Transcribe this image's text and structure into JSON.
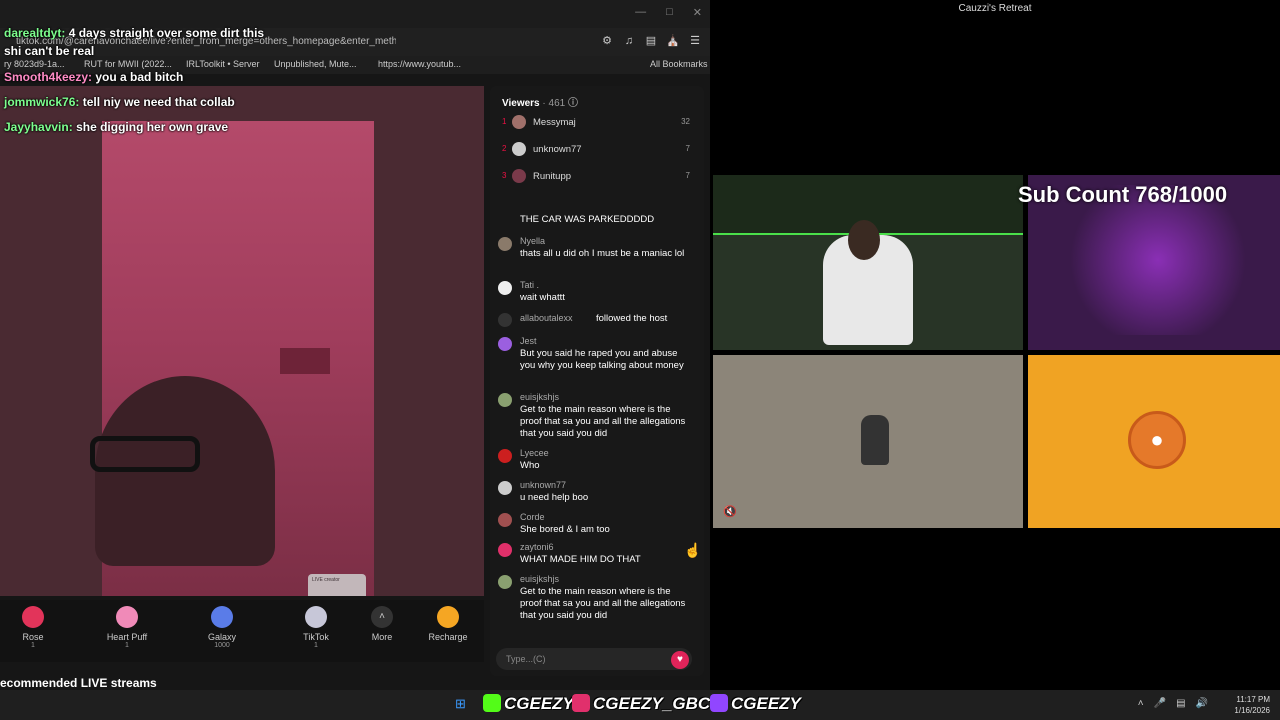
{
  "browser": {
    "url": "tiktok.com/@carenavonchaee/live?enter_from_merge=others_homepage&enter_metho...",
    "bookmarks": [
      "ry 8023d9-1a...",
      "RUT for MWII (2022...",
      "IRLToolkit • Server",
      "Unpublished, Mute...",
      "https://www.youtub...",
      "All Bookmarks"
    ]
  },
  "overlay_chat": [
    {
      "name": "darealtdyt:",
      "msg": "4 days straight over some dirt this"
    },
    {
      "name": "",
      "msg": "shi can't be real"
    },
    {
      "name": "Smooth4keezy:",
      "msg": "you a bad bitch"
    },
    {
      "name": "jommwick76:",
      "msg": "tell niy we need that collab"
    },
    {
      "name": "Jayyhavvin:",
      "msg": "she digging her own grave"
    }
  ],
  "gifts": [
    {
      "label": "Rose",
      "cost": "1",
      "color": "#e2345a"
    },
    {
      "label": "Heart Puff",
      "cost": "1",
      "color": "#f08ab8"
    },
    {
      "label": "Galaxy",
      "cost": "1000",
      "color": "#5a7ce8"
    },
    {
      "label": "TikTok",
      "cost": "1",
      "color": "#c7c7d8"
    },
    {
      "label": "More",
      "cost": "",
      "color": "#333333"
    },
    {
      "label": "Recharge",
      "cost": "",
      "color": "#f5a623"
    }
  ],
  "recommended": "ecommended LIVE streams",
  "pip_label": "LIVE creator",
  "viewers": {
    "title": "Viewers",
    "count": "· 461",
    "top": [
      {
        "rank": "1",
        "name": "Messymaj",
        "score": "32"
      },
      {
        "rank": "2",
        "name": "unknown77",
        "score": "7"
      },
      {
        "rank": "3",
        "name": "Runitupp",
        "score": "7"
      }
    ]
  },
  "chat": [
    {
      "name": "",
      "text": "THE CAR WAS PARKEDDDDD",
      "color": "#555555"
    },
    {
      "name": "Nyella",
      "text": "thats all u did oh I must be a maniac lol",
      "color": "#8a7a6a"
    },
    {
      "name": "Tati .",
      "text": "wait whattt",
      "color": "#eeeeee"
    },
    {
      "name": "allaboutalexx",
      "text": "followed the host",
      "color": "#333333"
    },
    {
      "name": "Jest",
      "text": "But you said he raped you and abuse you why you keep talking about money",
      "color": "#9b5fe0"
    },
    {
      "name": "euisjkshjs",
      "text": "Get to the main reason where is the proof that sa you and all the allegations that you said you did",
      "color": "#8aa070"
    },
    {
      "name": "Lyecee",
      "text": "Who",
      "color": "#cc1f1f"
    },
    {
      "name": "unknown77",
      "text": "u need help boo",
      "color": "#cccccc"
    },
    {
      "name": "Corde",
      "text": "She bored & I am too",
      "color": "#a05050"
    },
    {
      "name": "zaytoni6",
      "text": "WHAT MADE HIM DO THAT",
      "color": "#e0306a"
    },
    {
      "name": "euisjkshjs",
      "text": "Get to the main reason where is the proof that sa you and all the allegations that you said you did",
      "color": "#8aa070"
    }
  ],
  "chat_input_placeholder": "Type...(C)",
  "right": {
    "window_title": "Cauzzi's Retreat",
    "sub_count": "Sub Count 768/1000"
  },
  "taskbar": {
    "kick": "CGEEZY",
    "instagram": "CGEEZY_GBC",
    "twitch": "CGEEZY",
    "time": "11:17 PM",
    "date": "1/16/2026"
  }
}
